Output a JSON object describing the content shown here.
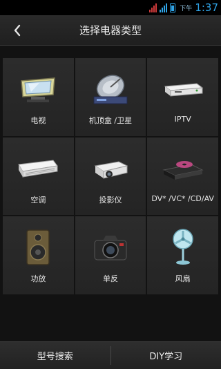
{
  "status_bar": {
    "ampm": "下午",
    "time": "1:37",
    "icons": [
      "signal-icon",
      "signal-icon",
      "battery-icon"
    ]
  },
  "header": {
    "title": "选择电器类型",
    "back_icon": "chevron-left-icon"
  },
  "devices": [
    {
      "label": "电视",
      "icon": "tv-icon"
    },
    {
      "label": "机顶盒 /卫星",
      "icon": "satellite-dish-icon"
    },
    {
      "label": "IPTV",
      "icon": "iptv-box-icon"
    },
    {
      "label": "空调",
      "icon": "air-conditioner-icon"
    },
    {
      "label": "投影仪",
      "icon": "projector-icon"
    },
    {
      "label": "DV* /VC* /CD/AV",
      "icon": "dvd-player-icon"
    },
    {
      "label": "功放",
      "icon": "speaker-icon"
    },
    {
      "label": "单反",
      "icon": "camera-icon"
    },
    {
      "label": "风扇",
      "icon": "fan-icon"
    }
  ],
  "bottom": {
    "model_search": "型号搜索",
    "diy_learn": "DIY学习"
  },
  "colors": {
    "accent": "#2fa4e7",
    "background": "#121212",
    "cell": "#2a2a2a"
  }
}
